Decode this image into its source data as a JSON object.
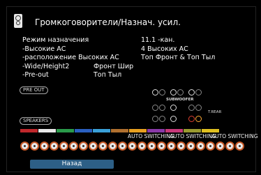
{
  "header": {
    "title": "Громкоговорители/Назнач. усил.",
    "icon": "speaker-icon"
  },
  "settings": [
    {
      "label": "Режим назначения",
      "value": "11.1 -кан."
    },
    {
      "label": "-Высокие АС",
      "value": "4 Высоких АС"
    },
    {
      "label": "-расположение Высоких АС",
      "value": "Топ Фронт & Топ Тыл"
    },
    {
      "label": "-Wide/Height2",
      "value": "Фронт Шир"
    },
    {
      "label": "-Pre-out",
      "value": "Топ Тыл"
    }
  ],
  "tags": {
    "pre_out": "PRE OUT",
    "speakers": "SPEAKERS"
  },
  "panel": {
    "subwoofer_label": "SUBWOOFER",
    "trear_label": "T.REAR"
  },
  "auto_switching": [
    "AUTO SWITCHING",
    "AUTO SWITCHING",
    "AUTO SWITCHING"
  ],
  "footer": {
    "back_label": "Назад"
  },
  "colors": {
    "accent": "#2d5f86",
    "terminal_ring": "#c85a28"
  }
}
